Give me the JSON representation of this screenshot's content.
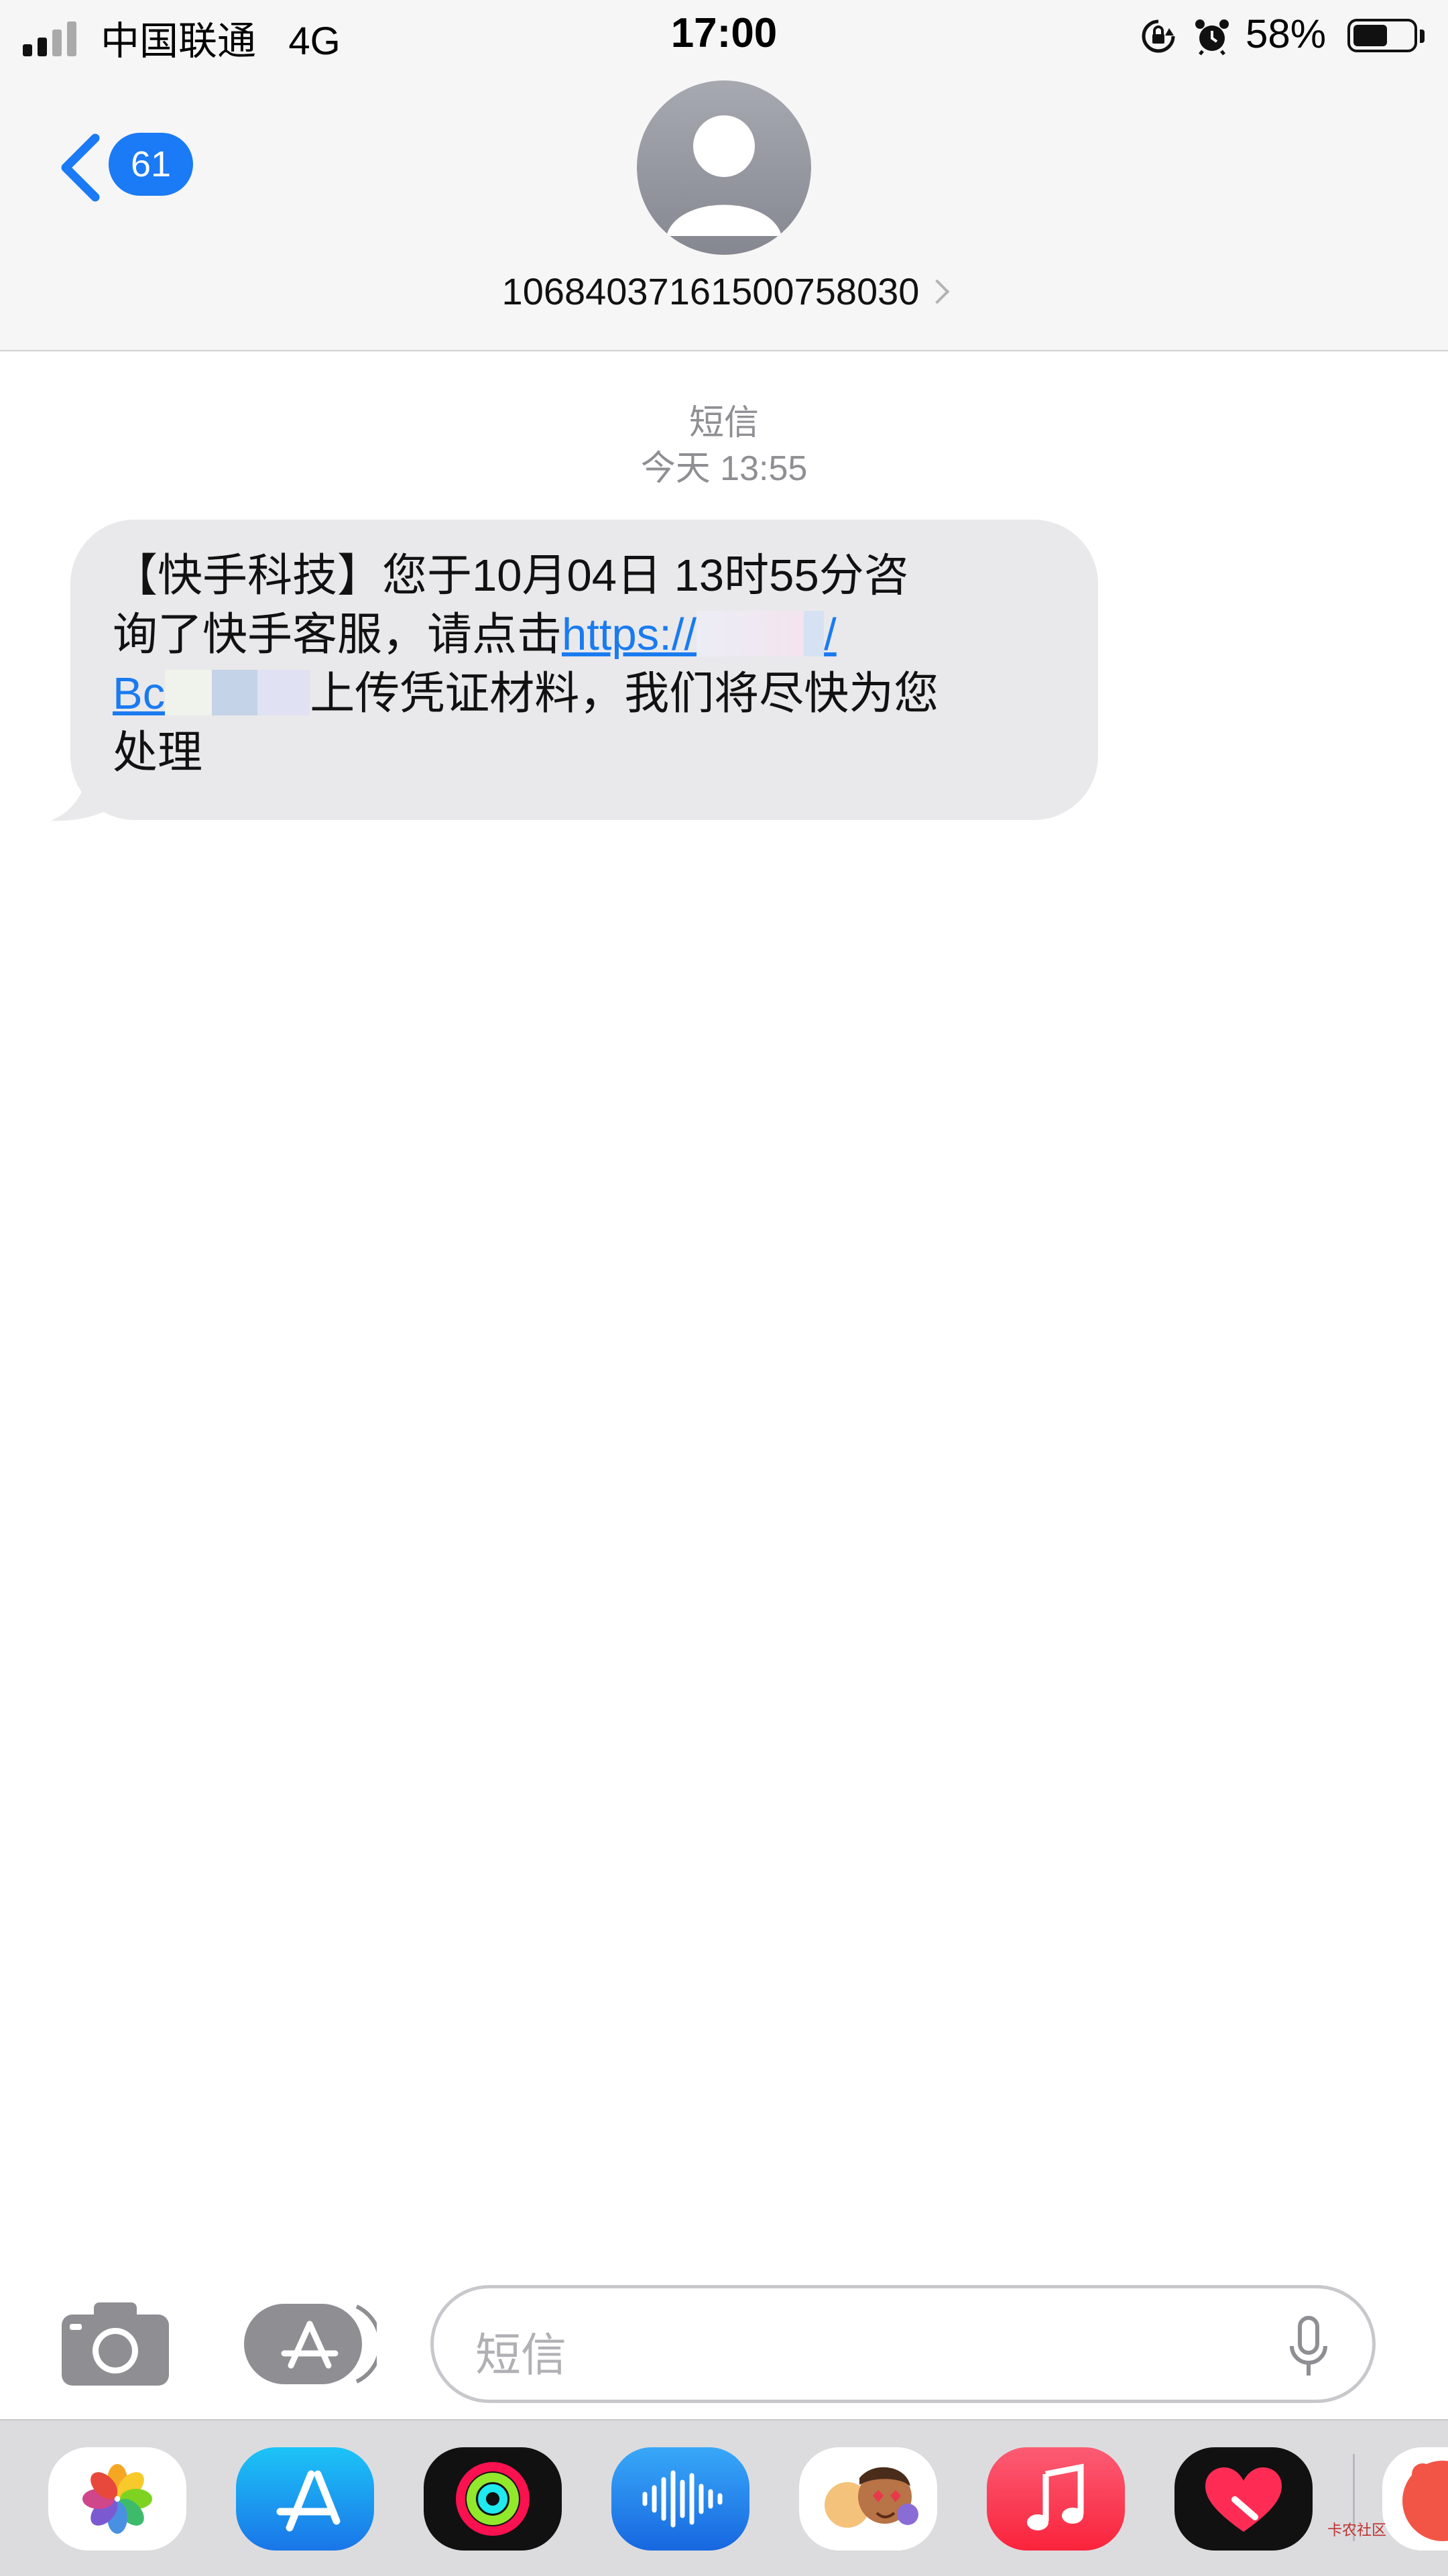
{
  "status_bar": {
    "carrier": "中国联通",
    "network": "4G",
    "time": "17:00",
    "battery": "58%",
    "battery_level": 0.58
  },
  "header": {
    "unread_count": "61",
    "contact_number": "10684037161500758030"
  },
  "thread": {
    "label": "短信",
    "timestamp": "今天 13:55"
  },
  "message": {
    "line1": "【快手科技】您于10月04日 13时55分咨",
    "line2_text": "询了快手客服，请点击",
    "link_start": "https://",
    "link_mid": "/",
    "link_end": "Bc",
    "line3_text": "上传凭证材料，我们将尽快为您",
    "line4": "处理"
  },
  "compose": {
    "placeholder": "短信"
  },
  "app_drawer": {
    "apps": [
      "photos-app",
      "app-store-app",
      "activity-app",
      "audio-message-app",
      "memoji-app",
      "music-app",
      "digital-touch-app",
      "extra-app"
    ]
  },
  "watermark": "卡农社区",
  "colors": {
    "accent_blue": "#1b7af5",
    "bubble_gray": "#e9e9eb",
    "header_bg": "#f6f6f6"
  }
}
